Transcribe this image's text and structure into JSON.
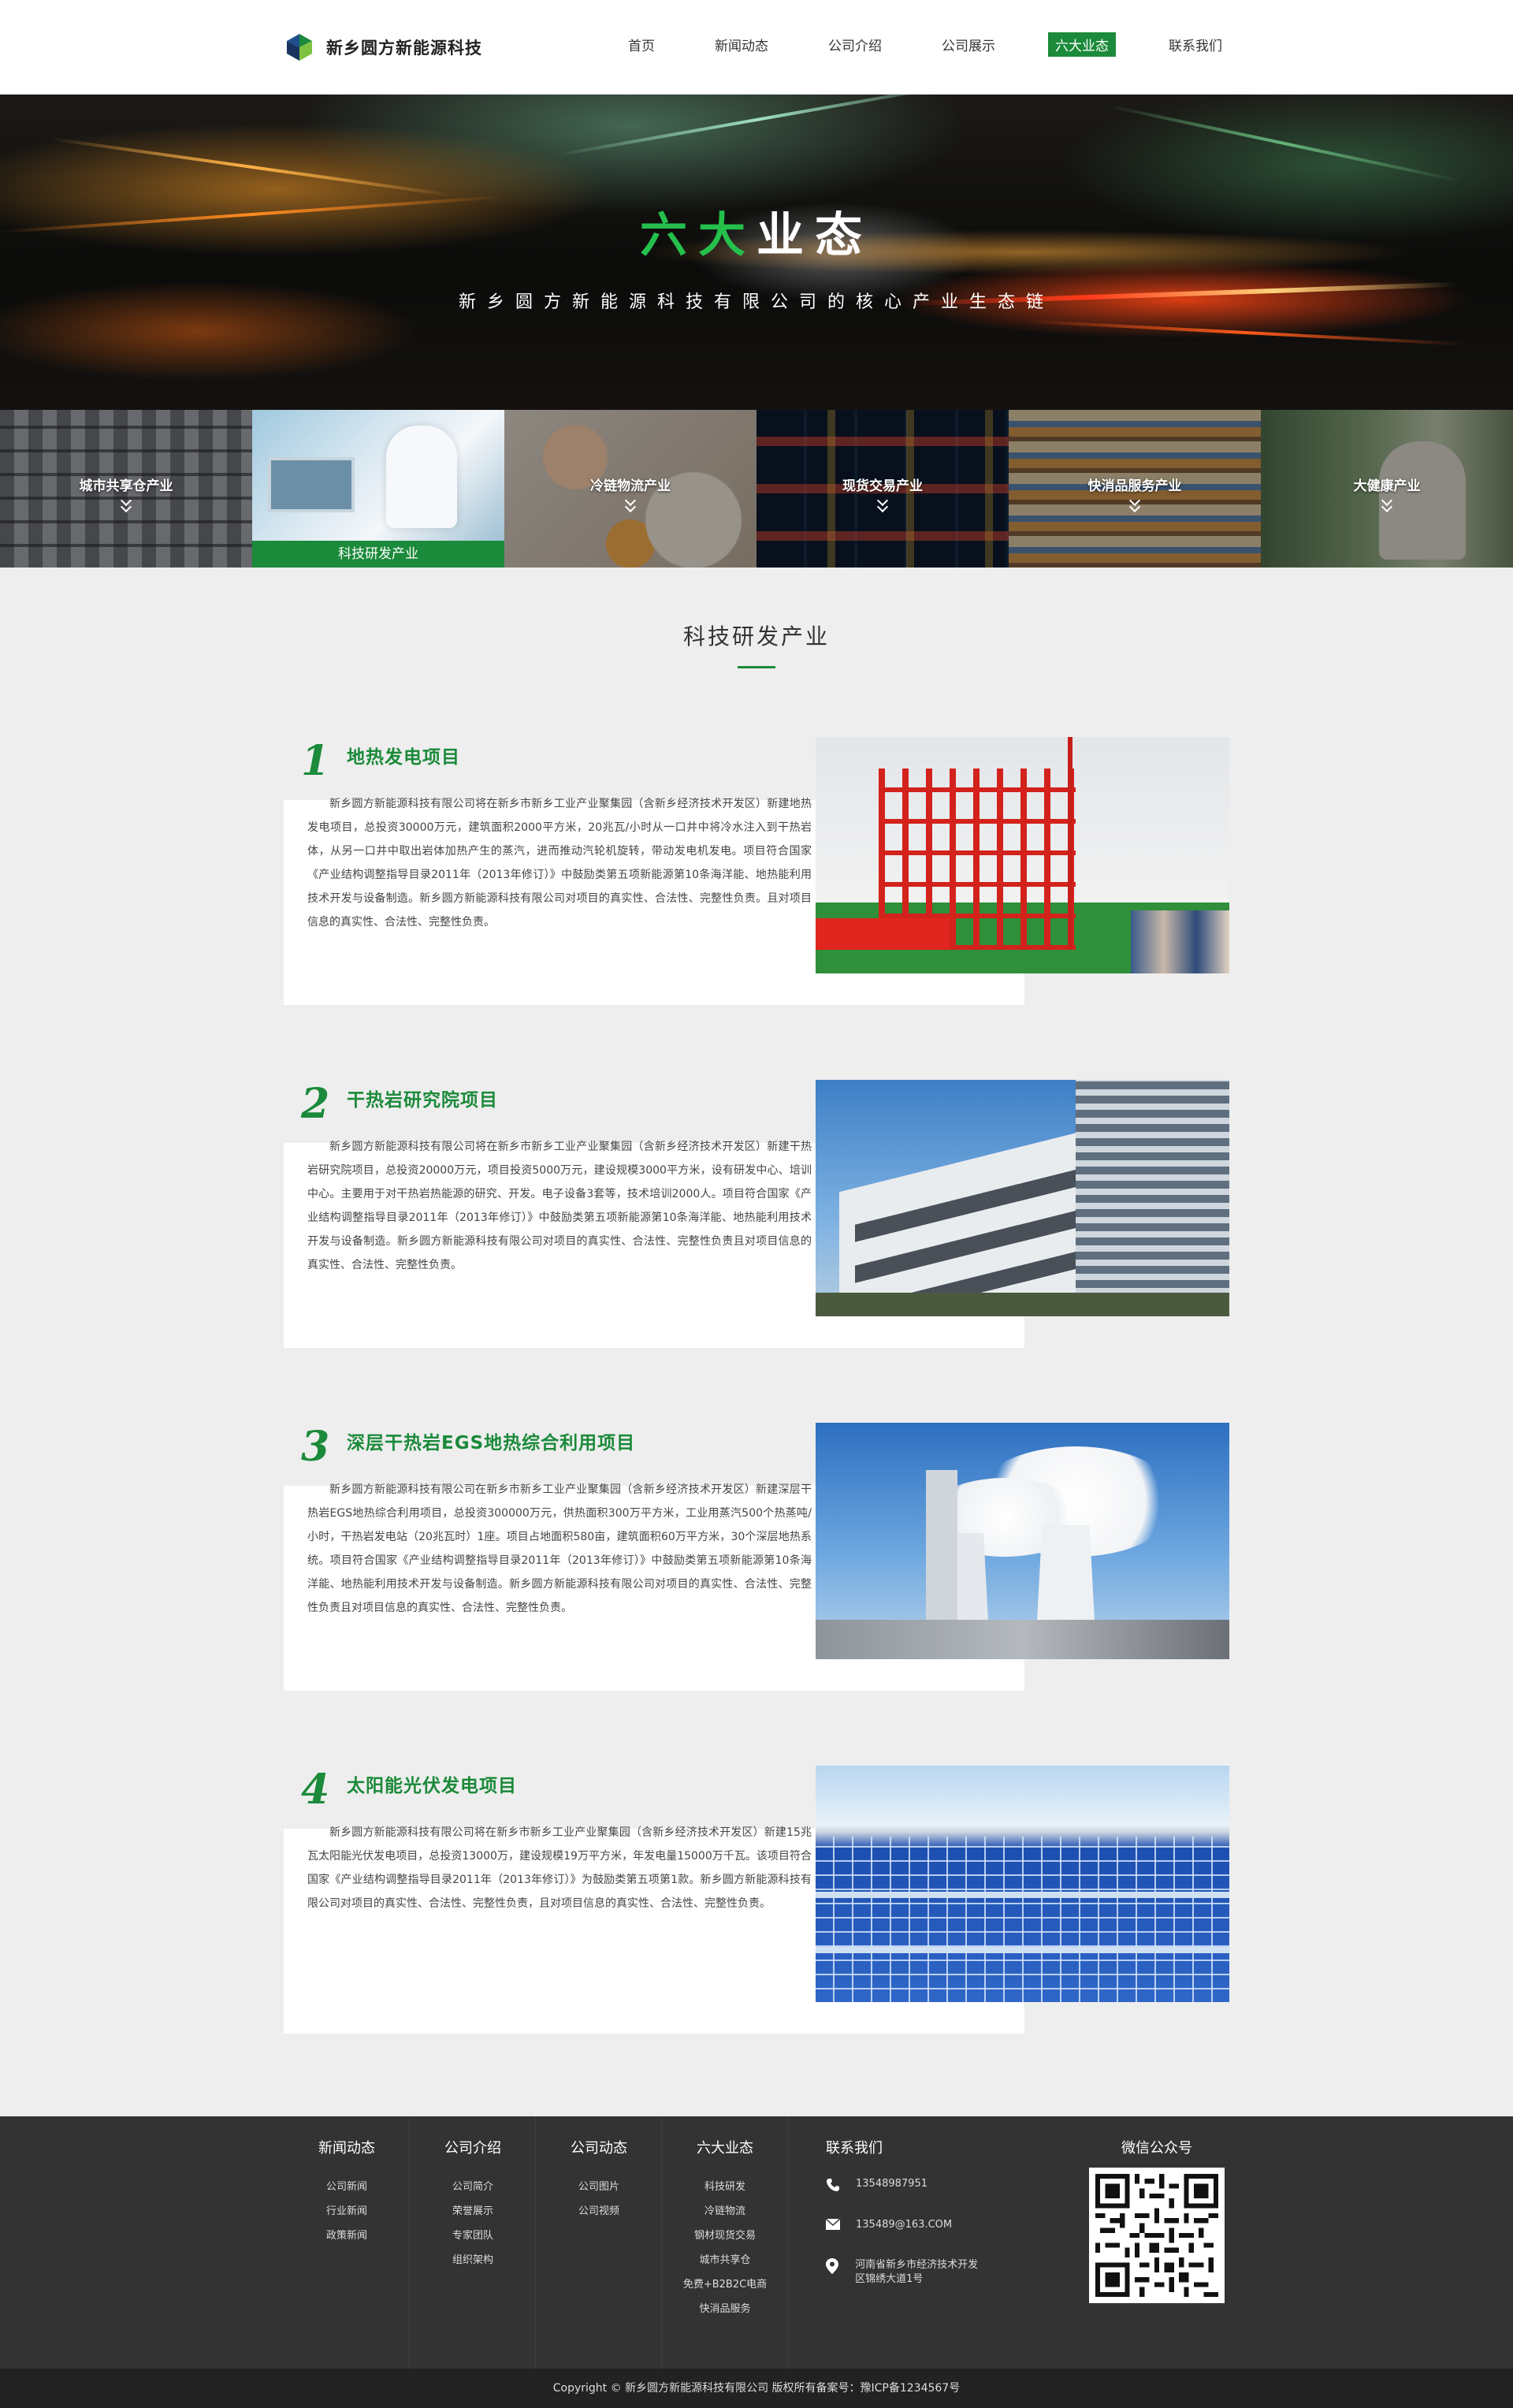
{
  "header": {
    "logo_text": "新乡圆方新能源科技",
    "nav": [
      "首页",
      "新闻动态",
      "公司介绍",
      "公司展示",
      "六大业态",
      "联系我们"
    ],
    "active_nav": "六大业态"
  },
  "banner": {
    "title_green": "六大",
    "title_white": "业态",
    "subtitle": "新乡圆方新能源科技有限公司的核心产业生态链"
  },
  "categories": [
    {
      "label": "城市共享仓产业",
      "active": false
    },
    {
      "label": "科技研发产业",
      "active": true
    },
    {
      "label": "冷链物流产业",
      "active": false
    },
    {
      "label": "现货交易产业",
      "active": false
    },
    {
      "label": "快消品服务产业",
      "active": false
    },
    {
      "label": "大健康产业",
      "active": false
    }
  ],
  "section": {
    "title": "科技研发产业"
  },
  "projects": [
    {
      "num": "1",
      "title": "地热发电项目",
      "text": "新乡圆方新能源科技有限公司将在新乡市新乡工业产业聚集园（含新乡经济技术开发区）新建地热发电项目，总投资30000万元，建筑面积2000平方米，20兆瓦/小时从一口井中将冷水注入到干热岩体，从另一口井中取出岩体加热产生的蒸汽，进而推动汽轮机旋转，带动发电机发电。项目符合国家《产业结构调整指导目录2011年（2013年修订）》中鼓励类第五项新能源第10条海洋能、地热能利用技术开发与设备制造。新乡圆方新能源科技有限公司对项目的真实性、合法性、完整性负责。且对项目信息的真实性、合法性、完整性负责。"
    },
    {
      "num": "2",
      "title": "干热岩研究院项目",
      "text": "新乡圆方新能源科技有限公司将在新乡市新乡工业产业聚集园（含新乡经济技术开发区）新建干热岩研究院项目，总投资20000万元，项目投资5000万元，建设规模3000平方米，设有研发中心、培训中心。主要用于对干热岩热能源的研究、开发。电子设备3套等，技术培训2000人。项目符合国家《产业结构调整指导目录2011年（2013年修订）》中鼓励类第五项新能源第10条海洋能、地热能利用技术开发与设备制造。新乡圆方新能源科技有限公司对项目的真实性、合法性、完整性负责且对项目信息的真实性、合法性、完整性负责。"
    },
    {
      "num": "3",
      "title": "深层干热岩EGS地热综合利用项目",
      "text": "新乡圆方新能源科技有限公司在新乡市新乡工业产业聚集园（含新乡经济技术开发区）新建深层干热岩EGS地热综合利用项目，总投资300000万元，供热面积300万平方米，工业用蒸汽500个热蒸吨/小时，干热岩发电站（20兆瓦时）1座。项目占地面积580亩，建筑面积60万平方米，30个深层地热系统。项目符合国家《产业结构调整指导目录2011年（2013年修订）》中鼓励类第五项新能源第10条海洋能、地热能利用技术开发与设备制造。新乡圆方新能源科技有限公司对项目的真实性、合法性、完整性负责且对项目信息的真实性、合法性、完整性负责。"
    },
    {
      "num": "4",
      "title": "太阳能光伏发电项目",
      "text": "新乡圆方新能源科技有限公司将在新乡市新乡工业产业聚集园（含新乡经济技术开发区）新建15兆瓦太阳能光伏发电项目，总投资13000万，建设规模19万平方米，年发电量15000万千瓦。该项目符合国家《产业结构调整指导目录2011年（2013年修订）》为鼓励类第五项第1款。新乡圆方新能源科技有限公司对项目的真实性、合法性、完整性负责，且对项目信息的真实性、合法性、完整性负责。"
    }
  ],
  "footer": {
    "columns": [
      {
        "title": "新闻动态",
        "links": [
          "公司新闻",
          "行业新闻",
          "政策新闻"
        ]
      },
      {
        "title": "公司介绍",
        "links": [
          "公司简介",
          "荣誉展示",
          "专家团队",
          "组织架构"
        ]
      },
      {
        "title": "公司动态",
        "links": [
          "公司图片",
          "公司视频"
        ]
      },
      {
        "title": "六大业态",
        "links": [
          "科技研发",
          "冷链物流",
          "钢材现货交易",
          "城市共享仓",
          "免费+B2B2C电商",
          "快消品服务"
        ]
      }
    ],
    "contact_title": "联系我们",
    "phone": "13548987951",
    "email": "135489@163.COM",
    "address": "河南省新乡市经济技术开发区锦绣大道1号",
    "wechat_title": "微信公众号",
    "copyright": "Copyright ©   新乡圆方新能源科技有限公司 版权所有备案号：豫ICP备1234567号"
  },
  "colors": {
    "brand_green": "#1b8a3a",
    "footer_bg": "#333333",
    "page_bg": "#eeeeee"
  }
}
